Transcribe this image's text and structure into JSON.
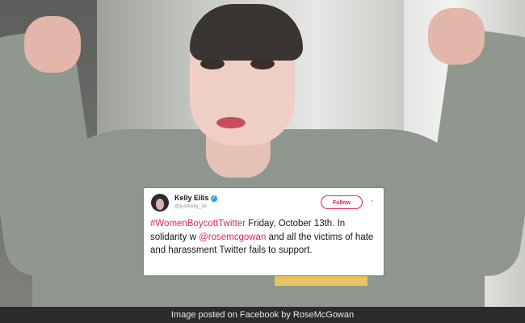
{
  "tweet": {
    "author_name": "Kelly Ellis",
    "handle": "@justkelly_ok",
    "follow_label": "Follow",
    "hashtag": "#WomenBoycottTwitter",
    "text_part1": " Friday, October 13th. In solidarity w ",
    "mention": "@rosemcgowan",
    "text_part2": " and all the victims of hate and harassment Twitter fails to support.",
    "icons": {
      "verified": "verified-badge-icon",
      "menu": "chevron-down-icon"
    },
    "colors": {
      "accent": "#e0245e",
      "verified": "#1da1f2"
    }
  },
  "caption": "Image posted on Facebook by RoseMcGowan"
}
